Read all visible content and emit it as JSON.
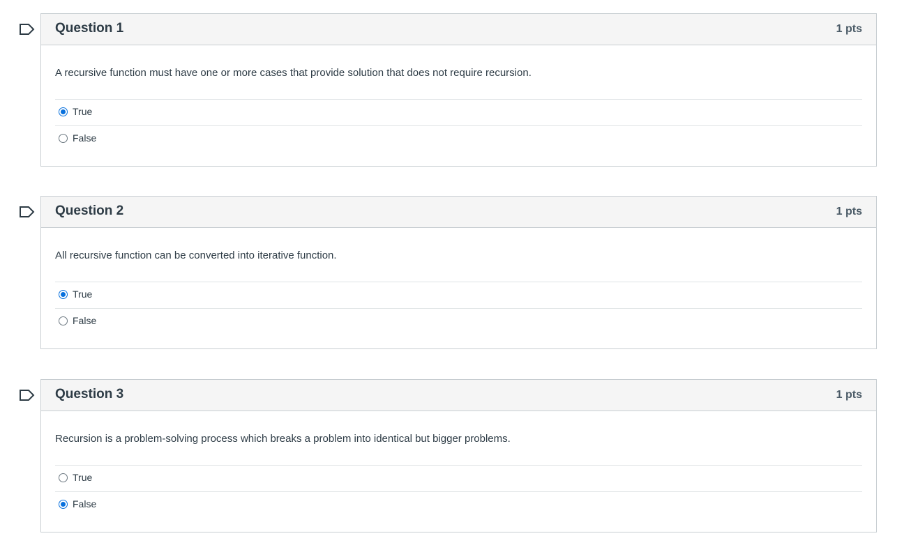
{
  "colors": {
    "accent": "#0770dd",
    "header_bg": "#f5f5f5",
    "border": "#c7cdd1",
    "text": "#2d3b45"
  },
  "questions": [
    {
      "title": "Question 1",
      "points": "1 pts",
      "text": "A recursive function must have one or more cases that provide solution that does not require recursion.",
      "flag_icon": "bookmark-flag-icon",
      "answers": [
        {
          "label": "True",
          "selected": true
        },
        {
          "label": "False",
          "selected": false
        }
      ]
    },
    {
      "title": "Question 2",
      "points": "1 pts",
      "text": "All recursive function can be converted into iterative function.",
      "flag_icon": "bookmark-flag-icon",
      "answers": [
        {
          "label": "True",
          "selected": true
        },
        {
          "label": "False",
          "selected": false
        }
      ]
    },
    {
      "title": "Question 3",
      "points": "1 pts",
      "text": "Recursion is a problem-solving process which breaks a problem into identical but bigger problems.",
      "flag_icon": "bookmark-flag-icon",
      "answers": [
        {
          "label": "True",
          "selected": false
        },
        {
          "label": "False",
          "selected": true
        }
      ]
    }
  ]
}
